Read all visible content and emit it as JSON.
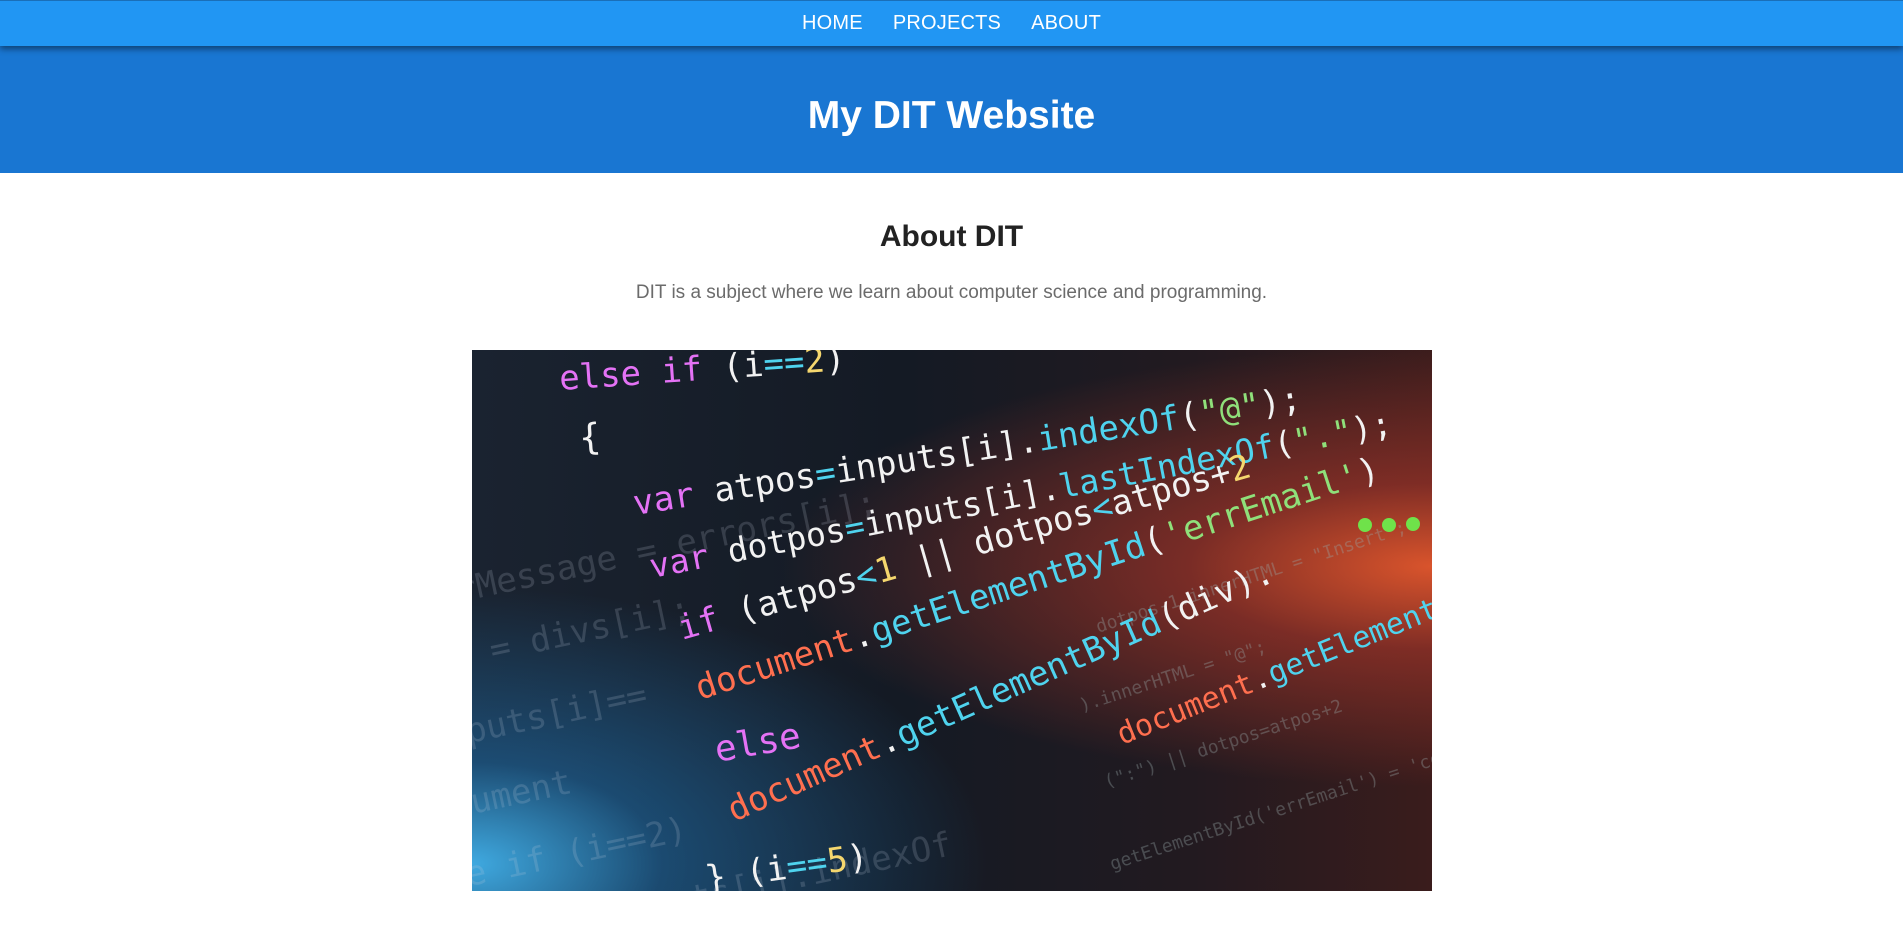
{
  "nav": {
    "items": [
      {
        "label": "HOME"
      },
      {
        "label": "PROJECTS"
      },
      {
        "label": "ABOUT"
      }
    ]
  },
  "header": {
    "title": "My DIT Website"
  },
  "about": {
    "heading": "About DIT",
    "description": "DIT is a subject where we learn about computer science and programming."
  },
  "image": {
    "alt": "Close-up of JavaScript code on a dark screen",
    "code_lines": [
      "else if (i==2)",
      "{",
      "var atpos=inputs[i].indexOf(\"@\");",
      "var dotpos=inputs[i].lastIndexOf(\".\");",
      "if (atpos<1 || dotpos<atpos+2",
      "document.getElementById('errEmail')",
      "document.getElementById(div).",
      "else",
      "document.getElementById(div).",
      "} (i==5)"
    ],
    "colors": {
      "keyword": "#e472f5",
      "plain": "#f2f2f2",
      "method": "#4fd3ee",
      "number": "#f5d76e",
      "object": "#ff6f4f",
      "string": "#8fe07a"
    }
  }
}
